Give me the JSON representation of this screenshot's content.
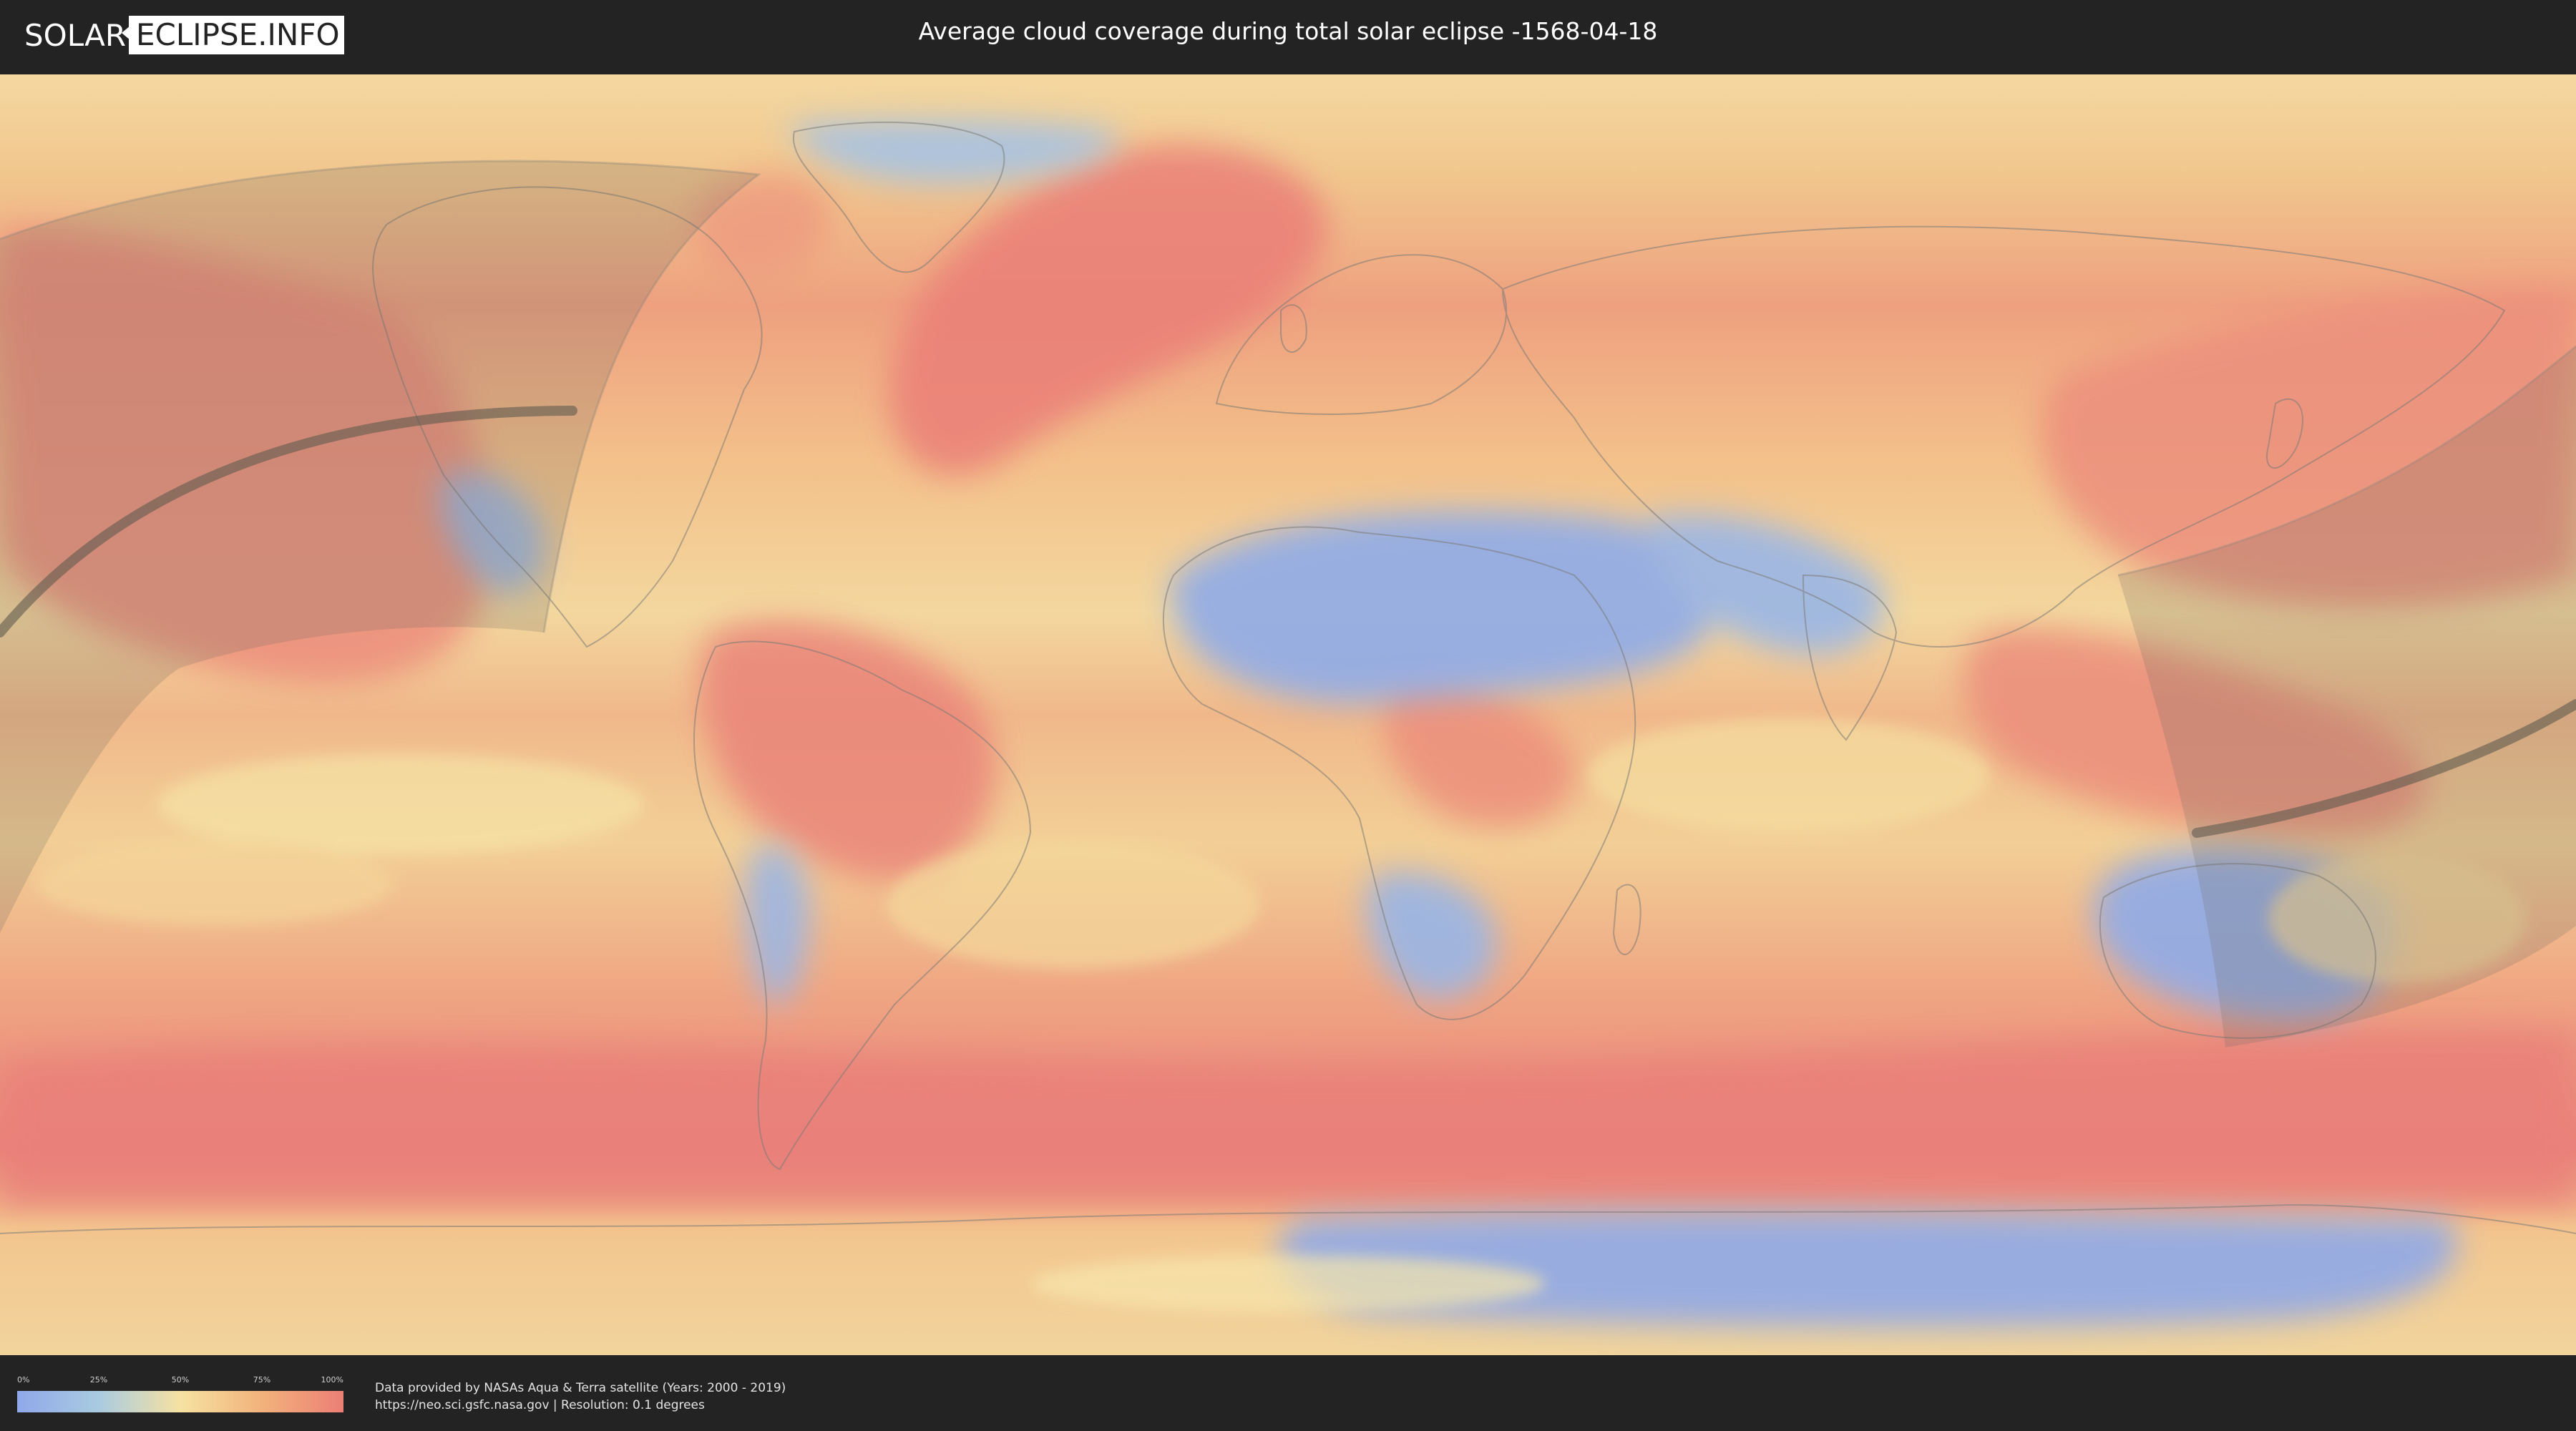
{
  "header": {
    "logo": {
      "part1": "SOLAR",
      "part2": "ECLIPSE.INFO"
    },
    "title": "Average cloud coverage during total solar eclipse -1568-04-18"
  },
  "map": {
    "type": "cloud-coverage-world-map",
    "projection": "equirectangular",
    "eclipse_path": "total",
    "colors": {
      "clear": "#8fa8ea",
      "low": "#a9cbe0",
      "mid": "#f6e2a2",
      "high": "#f2b27c",
      "overcast": "#ec7f75",
      "shadow_band": "#6e6a5e",
      "centerline": "#5f5a4e",
      "borders": "#7a7a7a"
    }
  },
  "legend": {
    "ticks": [
      "0%",
      "25%",
      "50%",
      "75%",
      "100%"
    ],
    "colors": [
      "#8fa8ea",
      "#a9cbe0",
      "#f6e2a2",
      "#f2b27c",
      "#ec7f75"
    ]
  },
  "footer": {
    "credit_line1": "Data provided by NASAs Aqua & Terra satellite (Years: 2000 - 2019)",
    "credit_line2": "https://neo.sci.gsfc.nasa.gov | Resolution: 0.1 degrees"
  }
}
